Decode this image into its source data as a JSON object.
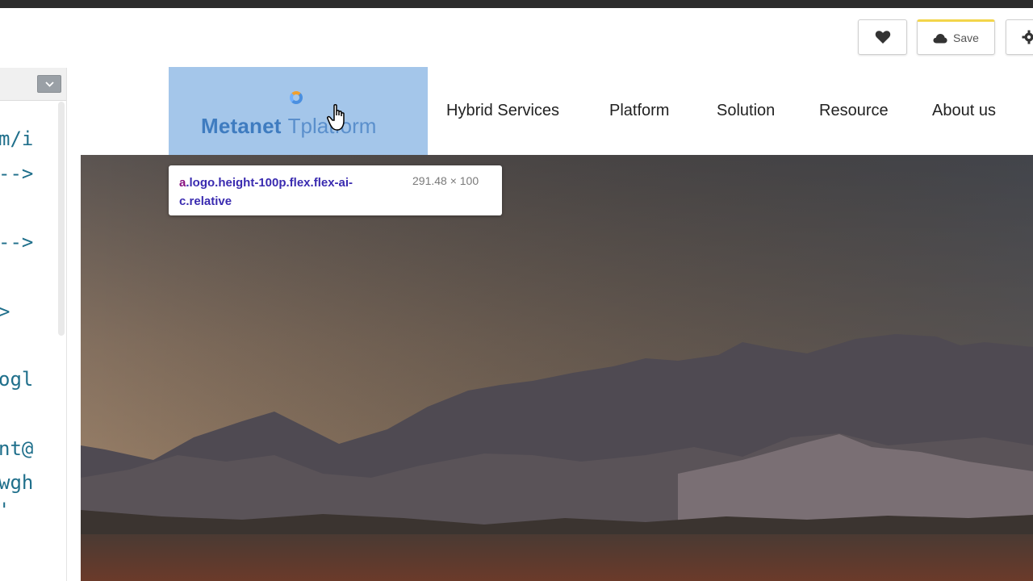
{
  "toolbar": {
    "favorite_icon": "heart-icon",
    "save_icon": "cloud-icon",
    "save_label": "Save",
    "settings_icon": "gear-icon"
  },
  "devtools": {
    "dropdown_icon": "chevron-down-icon",
    "code_lines": [
      "m/i",
      "-->",
      "-->",
      ">",
      "ogl",
      "nt@",
      "wgh",
      "'"
    ]
  },
  "site": {
    "logo": {
      "main": "Metanet",
      "sub": "Tplatform"
    },
    "nav": [
      "Hybrid Services",
      "Platform",
      "Solution",
      "Resource",
      "About us"
    ]
  },
  "inspector_tooltip": {
    "tag": "a",
    "selector": ".logo.height-100p.flex.flex-ai-c.relative",
    "size": "291.48 × 100"
  },
  "colors": {
    "highlight": "#a4c6ea",
    "logo": "#3f7cc0",
    "save_accent": "#f3d54a",
    "code": "#1f6f8b"
  }
}
